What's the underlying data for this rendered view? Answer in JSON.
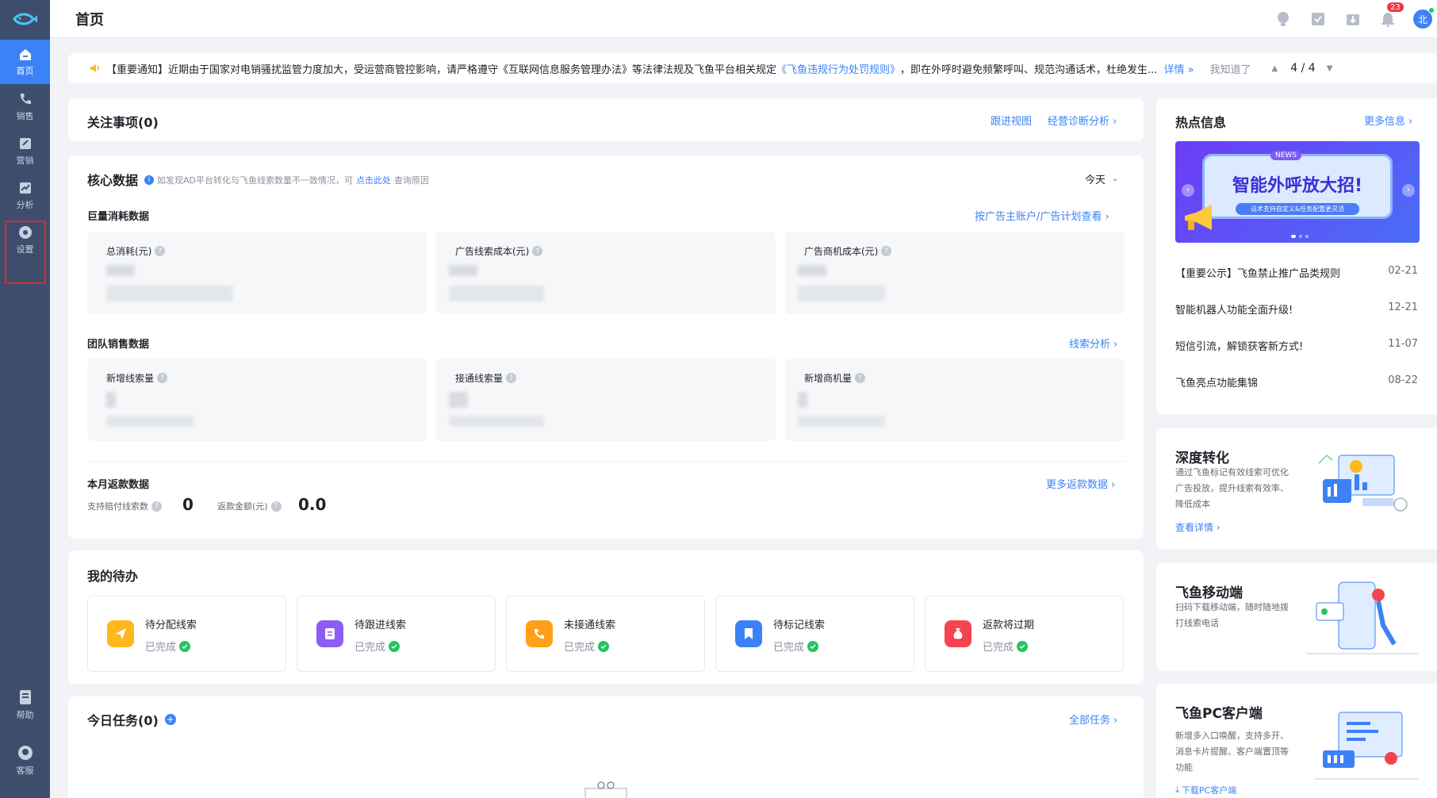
{
  "sidebar": {
    "items": [
      {
        "label": "首页",
        "icon": "home-icon"
      },
      {
        "label": "销售",
        "icon": "phone-icon"
      },
      {
        "label": "营销",
        "icon": "marketing-icon"
      },
      {
        "label": "分析",
        "icon": "chart-icon"
      },
      {
        "label": "设置",
        "icon": "gear-icon"
      }
    ],
    "bottom": [
      {
        "label": "帮助",
        "icon": "help-doc-icon"
      },
      {
        "label": "客服",
        "icon": "headset-icon"
      }
    ]
  },
  "header": {
    "title": "首页",
    "notification_count": "23",
    "avatar_text": "北"
  },
  "notice": {
    "text_before": "【重要通知】近期由于国家对电销骚扰监管力度加大，受运营商管控影响，请严格遵守《互联网信息服务管理办法》等法律法规及飞鱼平台相关规定",
    "rule_link": "《飞鱼违规行为处罚规则》",
    "text_after": "，即在外呼时避免频繁呼叫、规范沟通话术，杜绝发生...",
    "detail_link": "详情 »",
    "dismiss": "我知道了",
    "pager": "4 / 4"
  },
  "focus": {
    "title": "关注事项(0)",
    "link1": "跟进视图",
    "link2": "经营诊断分析 ›"
  },
  "core": {
    "title": "核心数据",
    "hint_before": "如发现AD平台转化与飞鱼线索数量不一致情况，可",
    "hint_link": "点击此处",
    "hint_after": "查询原因",
    "period": "今天",
    "section1": "巨量消耗数据",
    "section1_link": "按广告主账户/广告计划查看 ›",
    "metrics1": [
      "总消耗(元)",
      "广告线索成本(元)",
      "广告商机成本(元)"
    ],
    "section2": "团队销售数据",
    "section2_link": "线索分析 ›",
    "metrics2": [
      "新增线索量",
      "接通线索量",
      "新增商机量"
    ],
    "section3": "本月返款数据",
    "section3_link": "更多返款数据 ›",
    "refund_label1": "支持赔付线索数",
    "refund_value1": "0",
    "refund_label2": "返款金额(元)",
    "refund_value2": "0.0"
  },
  "todo": {
    "title": "我的待办",
    "items": [
      {
        "title": "待分配线索",
        "status": "已完成",
        "color": "#ffb81c"
      },
      {
        "title": "待跟进线索",
        "status": "已完成",
        "color": "#8b5cf6"
      },
      {
        "title": "未接通线索",
        "status": "已完成",
        "color": "#ff9f1a"
      },
      {
        "title": "待标记线索",
        "status": "已完成",
        "color": "#3b82f6"
      },
      {
        "title": "返款将过期",
        "status": "已完成",
        "color": "#f5444f"
      }
    ]
  },
  "tasks": {
    "title": "今日任务(0)",
    "link": "全部任务 ›"
  },
  "hot": {
    "title": "热点信息",
    "more": "更多信息 ›",
    "banner_title": "智能外呼放大招!",
    "banner_sub": "话术支持自定义&任务配置更灵活",
    "banner_tag": "NEWS",
    "items": [
      {
        "title": "【重要公示】飞鱼禁止推广品类规则",
        "date": "02-21"
      },
      {
        "title": "智能机器人功能全面升级!",
        "date": "12-21"
      },
      {
        "title": "短信引流，解锁获客新方式!",
        "date": "11-07"
      },
      {
        "title": "飞鱼亮点功能集锦",
        "date": "08-22"
      }
    ]
  },
  "promo1": {
    "title": "深度转化",
    "desc": "通过飞鱼标记有效线索可优化广告投放，提升线索有效率、降低成本",
    "link": "查看详情 ›"
  },
  "promo2": {
    "title": "飞鱼移动端",
    "desc": "扫码下载移动端，随时随地拨打线索电话"
  },
  "promo3": {
    "title": "飞鱼PC客户端",
    "desc": "新增多入口唤醒，支持多开、消息卡片提醒、客户端置顶等功能",
    "link": "下载PC客户端"
  }
}
